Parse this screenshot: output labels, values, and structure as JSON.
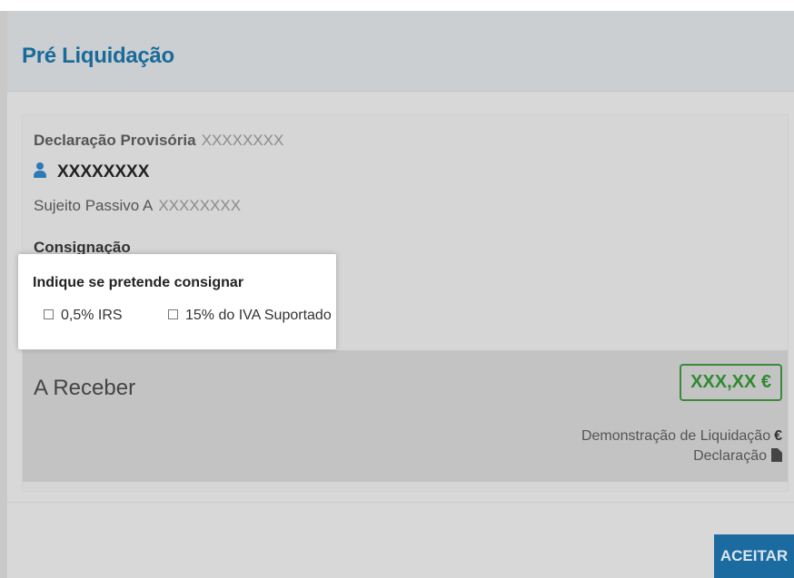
{
  "modal": {
    "title": "Pré Liquidação"
  },
  "declaracao": {
    "label": "Declaração Provisória",
    "value": "XXXXXXXX"
  },
  "user": {
    "name": "XXXXXXXX",
    "icon": "user-icon"
  },
  "sujeito_passivo": {
    "label": "Sujeito Passivo A",
    "value": "XXXXXXXX"
  },
  "consignacao": {
    "heading": "Consignação",
    "question": "Indique se pretende consignar",
    "options": [
      {
        "label": "0,5% IRS",
        "checked": false
      },
      {
        "label": "15% do IVA Suportado",
        "checked": false
      }
    ]
  },
  "receber": {
    "label": "A Receber",
    "amount": "XXX,XX €",
    "demo_link": "Demonstração de Liquidação",
    "demo_icon": "euro-icon",
    "decl_link": "Declaração",
    "decl_icon": "file-icon"
  },
  "actions": {
    "accept_label": "ACEITAR"
  },
  "colors": {
    "title": "#1a6a9a",
    "accent_button": "#1b6aa0",
    "amount_green": "#2f8a2f"
  }
}
